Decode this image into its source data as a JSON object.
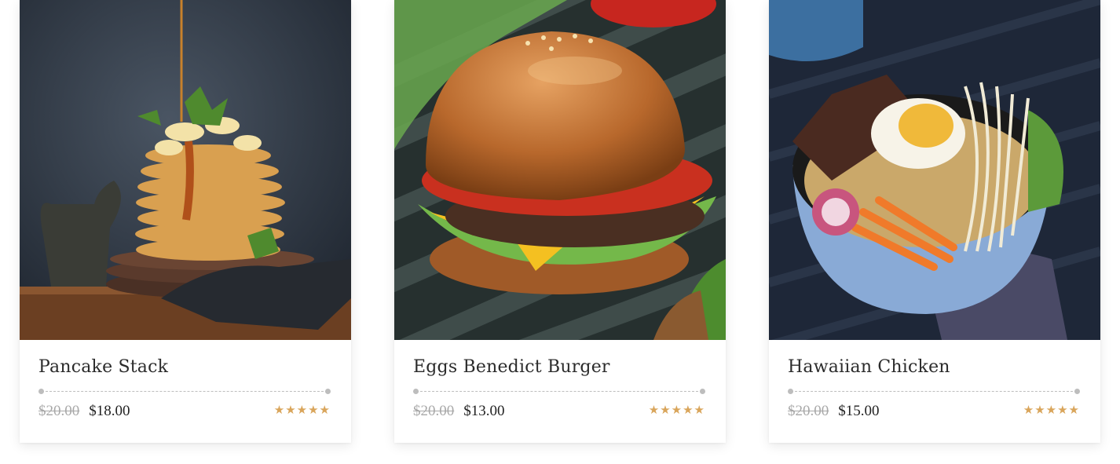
{
  "products": [
    {
      "title": "Pancake Stack",
      "old_price": "$20.00",
      "price": "$18.00",
      "rating": 5,
      "stars": "★★★★★",
      "image_icon": "pancake-image"
    },
    {
      "title": "Eggs Benedict Burger",
      "old_price": "$20.00",
      "price": "$13.00",
      "rating": 5,
      "stars": "★★★★★",
      "image_icon": "burger-image"
    },
    {
      "title": "Hawaiian Chicken",
      "old_price": "$20.00",
      "price": "$15.00",
      "rating": 5,
      "stars": "★★★★★",
      "image_icon": "bowl-image"
    }
  ],
  "colors": {
    "star": "#d9a55b",
    "old_price": "#a8a8a8",
    "title": "#2b2b2b"
  }
}
